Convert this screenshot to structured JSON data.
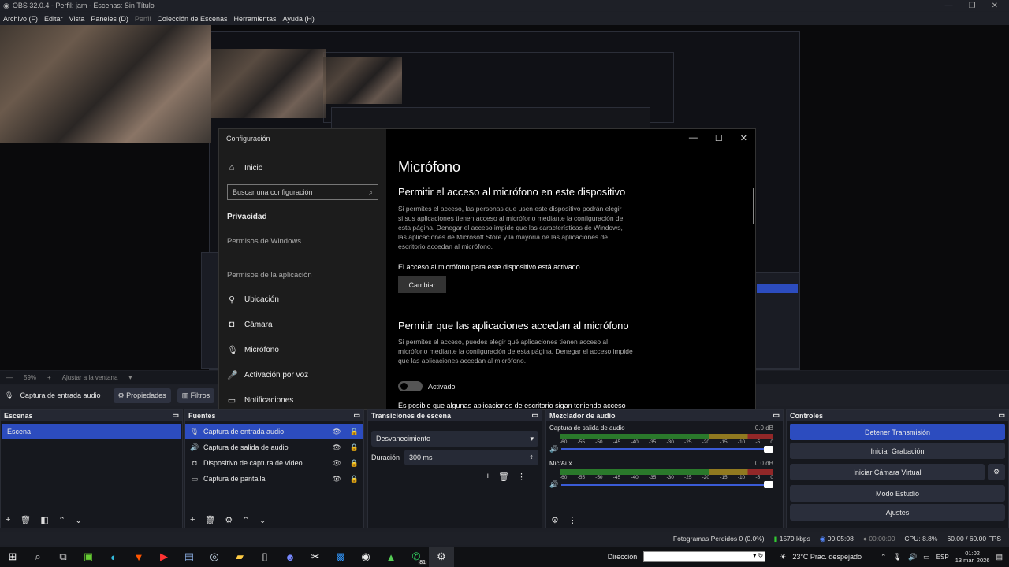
{
  "window": {
    "title": "OBS 32.0.4 - Perfil: jam - Escenas: Sin Título"
  },
  "menu": [
    "Archivo (F)",
    "Editar",
    "Vista",
    "Paneles (D)",
    "Perfil",
    "Colección de Escenas",
    "Herramientas",
    "Ayuda (H)"
  ],
  "zoom": {
    "level": "59%",
    "fit": "Ajustar a la ventana"
  },
  "context": {
    "source": "Captura de entrada audio",
    "properties": "Propiedades",
    "filters": "Filtros"
  },
  "scenes": {
    "title": "Escenas",
    "items": [
      "Escena"
    ]
  },
  "sources": {
    "title": "Fuentes",
    "items": [
      {
        "icon": "microphone-icon",
        "label": "Captura de entrada audio"
      },
      {
        "icon": "speaker-icon",
        "label": "Captura de salida de audio"
      },
      {
        "icon": "camera-icon",
        "label": "Dispositivo de captura de vídeo"
      },
      {
        "icon": "monitor-icon",
        "label": "Captura de pantalla"
      }
    ]
  },
  "transitions": {
    "title": "Transiciones de escena",
    "selected": "Desvanecimiento",
    "duration_label": "Duración",
    "duration": "300 ms"
  },
  "mixer": {
    "title": "Mezclador de audio",
    "channels": [
      {
        "name": "Captura de salida de audio",
        "db": "0.0 dB"
      },
      {
        "name": "Mic/Aux",
        "db": "0.0 dB"
      }
    ],
    "ticks": [
      "-60",
      "-55",
      "-50",
      "-45",
      "-40",
      "-35",
      "-30",
      "-25",
      "-20",
      "-15",
      "-10",
      "-5",
      "0"
    ]
  },
  "controls": {
    "title": "Controles",
    "buttons": [
      "Detener Transmisión",
      "Iniciar Grabación",
      "Iniciar Cámara Virtual",
      "Modo Estudio",
      "Ajustes"
    ]
  },
  "status": {
    "dropped": "Fotogramas Perdidos 0 (0.0%)",
    "bitrate": "1579 kbps",
    "stream_time": "00:05:08",
    "rec_time": "00:00:00",
    "cpu": "CPU: 8.8%",
    "fps": "60.00 / 60.00 FPS"
  },
  "taskbar": {
    "address_label": "Dirección",
    "weather": "23°C  Prac. despejado",
    "lang": "ESP",
    "time": "01:02",
    "date": "13 mar. 2026",
    "badge": "81"
  },
  "settings": {
    "window_title": "Configuración",
    "home": "Inicio",
    "search_placeholder": "Buscar una configuración",
    "section": "Privacidad",
    "windows_perms": "Permisos de Windows",
    "app_perms": "Permisos de la aplicación",
    "nav": [
      {
        "icon": "location-icon",
        "label": "Ubicación"
      },
      {
        "icon": "camera-icon",
        "label": "Cámara"
      },
      {
        "icon": "microphone-icon",
        "label": "Micrófono"
      },
      {
        "icon": "voice-activation-icon",
        "label": "Activación por voz"
      },
      {
        "icon": "notification-icon",
        "label": "Notificaciones"
      }
    ],
    "page_title": "Micrófono",
    "h1": "Permitir el acceso al micrófono en este dispositivo",
    "p1": "Si permites el acceso, las personas que usen este dispositivo podrán elegir si sus aplicaciones tienen acceso al micrófono mediante la configuración de esta página. Denegar el acceso impide que las características de Windows, las aplicaciones de Microsoft Store y la mayoría de las aplicaciones de escritorio accedan al micrófono.",
    "status": "El acceso al micrófono para este dispositivo está activado",
    "change_button": "Cambiar",
    "h2": "Permitir que las aplicaciones accedan al micrófono",
    "p2": "Si permites el acceso, puedes elegir qué aplicaciones tienen acceso al micrófono mediante la configuración de esta página. Denegar el acceso impide que las aplicaciones accedan al micrófono.",
    "toggle": "Activado",
    "p3": "Es posible que algunas aplicaciones de escritorio sigan teniendo acceso"
  },
  "colors": {
    "accent": "#2c4cbf",
    "panel": "#16181e",
    "header": "#252833"
  }
}
